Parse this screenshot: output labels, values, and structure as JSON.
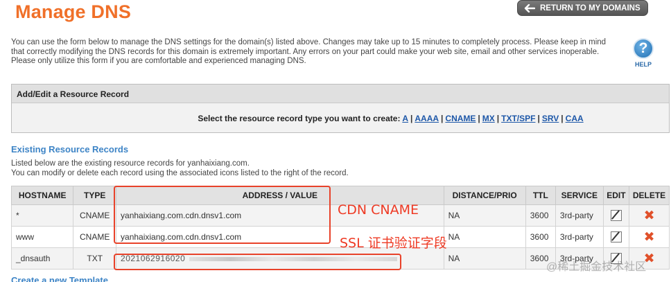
{
  "page": {
    "title": "Manage DNS",
    "return_label": "RETURN TO MY DOMAINS",
    "intro": "You can use the form below to manage the DNS settings for the domain(s) listed above. Changes may take up to 15 minutes to completely process. Please keep in mind that correctly modifying the DNS records for this domain is extremely important. Any errors on your part could make your web site, email and other services inoperable. Please only utilize this form if you are comfortable and experienced managing DNS.",
    "help_label": "HELP"
  },
  "add_record": {
    "heading": "Add/Edit a Resource Record",
    "prompt": "Select the resource record type you want to create:",
    "types": [
      "A",
      "AAAA",
      "CNAME",
      "MX",
      "TXT/SPF",
      "SRV",
      "CAA"
    ]
  },
  "existing": {
    "title": "Existing Resource Records",
    "line1": "Listed below are the existing resource records for yanhaixiang.com.",
    "line2": "You can modify or delete each record using the associated icons listed to the right of the record."
  },
  "table": {
    "headers": [
      "HOSTNAME",
      "TYPE",
      "ADDRESS / VALUE",
      "DISTANCE/PRIO",
      "TTL",
      "SERVICE",
      "EDIT",
      "DELETE"
    ],
    "rows": [
      {
        "host": "*",
        "type": "CNAME",
        "value": "yanhaixiang.com.cdn.dnsv1.com",
        "prio": "NA",
        "ttl": "3600",
        "service": "3rd-party"
      },
      {
        "host": "www",
        "type": "CNAME",
        "value": "yanhaixiang.com.cdn.dnsv1.com",
        "prio": "NA",
        "ttl": "3600",
        "service": "3rd-party"
      },
      {
        "host": "_dnsauth",
        "type": "TXT",
        "value": "2021062916020",
        "prio": "NA",
        "ttl": "3600",
        "service": "3rd-party"
      }
    ]
  },
  "annotations": {
    "cdn": "CDN CNAME",
    "ssl": "SSL 证书验证字段"
  },
  "footer_partial": "Create a new Template",
  "watermark": "@稀土掘金技术社区",
  "colors": {
    "title": "#f07029",
    "link": "#1d57a8",
    "section": "#3d84c6",
    "annotation": "#e8422a",
    "delete": "#e0502a"
  }
}
